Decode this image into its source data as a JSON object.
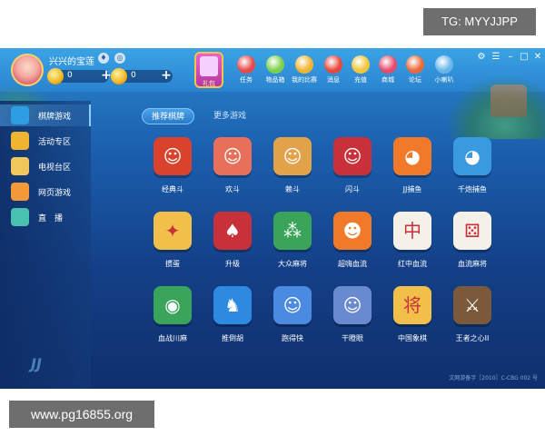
{
  "watermarks": {
    "top": "TG: MYYJJPP",
    "bottom": "www.pg16855.org"
  },
  "header": {
    "username": "兴兴的宝莲",
    "currency": [
      {
        "value": "0"
      },
      {
        "value": "0"
      }
    ],
    "gift_label": "礼包",
    "nav": [
      {
        "label": "任务",
        "icon": "task-icon",
        "color": "#e84a4a"
      },
      {
        "label": "物品箱",
        "icon": "item-box-icon",
        "color": "#7bd04a"
      },
      {
        "label": "我的比赛",
        "icon": "match-icon",
        "color": "#f0b530"
      },
      {
        "label": "消息",
        "icon": "message-icon",
        "color": "#e8483a"
      },
      {
        "label": "充值",
        "icon": "recharge-icon",
        "color": "#f2c53a"
      },
      {
        "label": "商城",
        "icon": "shop-icon",
        "color": "#e84a6a"
      },
      {
        "label": "论坛",
        "icon": "forum-icon",
        "color": "#e86a3a"
      },
      {
        "label": "小喇叭",
        "icon": "speaker-icon",
        "color": "#6ab6e8"
      }
    ],
    "window_controls": [
      "⚙",
      "☰",
      "–",
      "□",
      "✕"
    ]
  },
  "sidebar": {
    "items": [
      {
        "label": "棋牌游戏",
        "icon": "spade-icon",
        "color": "#2e9de2"
      },
      {
        "label": "活动专区",
        "icon": "gift-icon",
        "color": "#f0b530"
      },
      {
        "label": "电视台区",
        "icon": "tv-icon",
        "color": "#f1c65a"
      },
      {
        "label": "网页游戏",
        "icon": "web-game-icon",
        "color": "#f29a3a"
      },
      {
        "label": "直　播",
        "icon": "live-icon",
        "color": "#4ac0b0"
      }
    ],
    "logo_text": "JJ"
  },
  "tabs": [
    {
      "label": "推荐棋牌"
    },
    {
      "label": "更多游戏"
    }
  ],
  "games": [
    {
      "name": "经典斗",
      "icon": "fortune-god-icon",
      "color": "#d9432e",
      "glyph": "☺"
    },
    {
      "name": "欢斗",
      "icon": "girl-character-icon",
      "color": "#e8705a",
      "glyph": "☺"
    },
    {
      "name": "赖斗",
      "icon": "boy-character-icon",
      "color": "#e2a24a",
      "glyph": "☺"
    },
    {
      "name": "闪斗",
      "icon": "girl-red-icon",
      "color": "#c8303a",
      "glyph": "☺"
    },
    {
      "name": "JJ捕鱼",
      "icon": "clownfish-icon",
      "color": "#f07a2a",
      "glyph": "◕"
    },
    {
      "name": "千炮捕鱼",
      "icon": "blue-fish-icon",
      "color": "#3a9ae0",
      "glyph": "◕"
    },
    {
      "name": "掼蛋",
      "icon": "chicken-icon",
      "color": "#f2c04a",
      "glyph": "✦"
    },
    {
      "name": "升级",
      "icon": "tractor-icon",
      "color": "#c8303a",
      "glyph": "♠"
    },
    {
      "name": "大众麻将",
      "icon": "bamboo-tile-icon",
      "color": "#3aa55a",
      "glyph": "⁂"
    },
    {
      "name": "超嗨血流",
      "icon": "tiger-icon",
      "color": "#f07a2a",
      "glyph": "☻"
    },
    {
      "name": "红中血流",
      "icon": "red-zhong-tile-icon",
      "color": "#f5f0e8",
      "glyph": "中"
    },
    {
      "name": "血流麻将",
      "icon": "dice-icon",
      "color": "#f5f0e8",
      "glyph": "⚄"
    },
    {
      "name": "血战川麻",
      "icon": "panda-icon",
      "color": "#3aa55a",
      "glyph": "◉"
    },
    {
      "name": "推倒胡",
      "icon": "horse-icon",
      "color": "#2e8ae0",
      "glyph": "♞"
    },
    {
      "name": "跑得快",
      "icon": "runner-icon",
      "color": "#4a8ae0",
      "glyph": "☺"
    },
    {
      "name": "干瞪眼",
      "icon": "man-card-icon",
      "color": "#6a8ad0",
      "glyph": "☺"
    },
    {
      "name": "中国象棋",
      "icon": "chess-piece-icon",
      "color": "#f2c04a",
      "glyph": "将"
    },
    {
      "name": "王者之心II",
      "icon": "warrior-icon",
      "color": "#7a5a3a",
      "glyph": "⚔"
    }
  ],
  "footer_note": "文网游备字［2010］C-CBG 002 号"
}
